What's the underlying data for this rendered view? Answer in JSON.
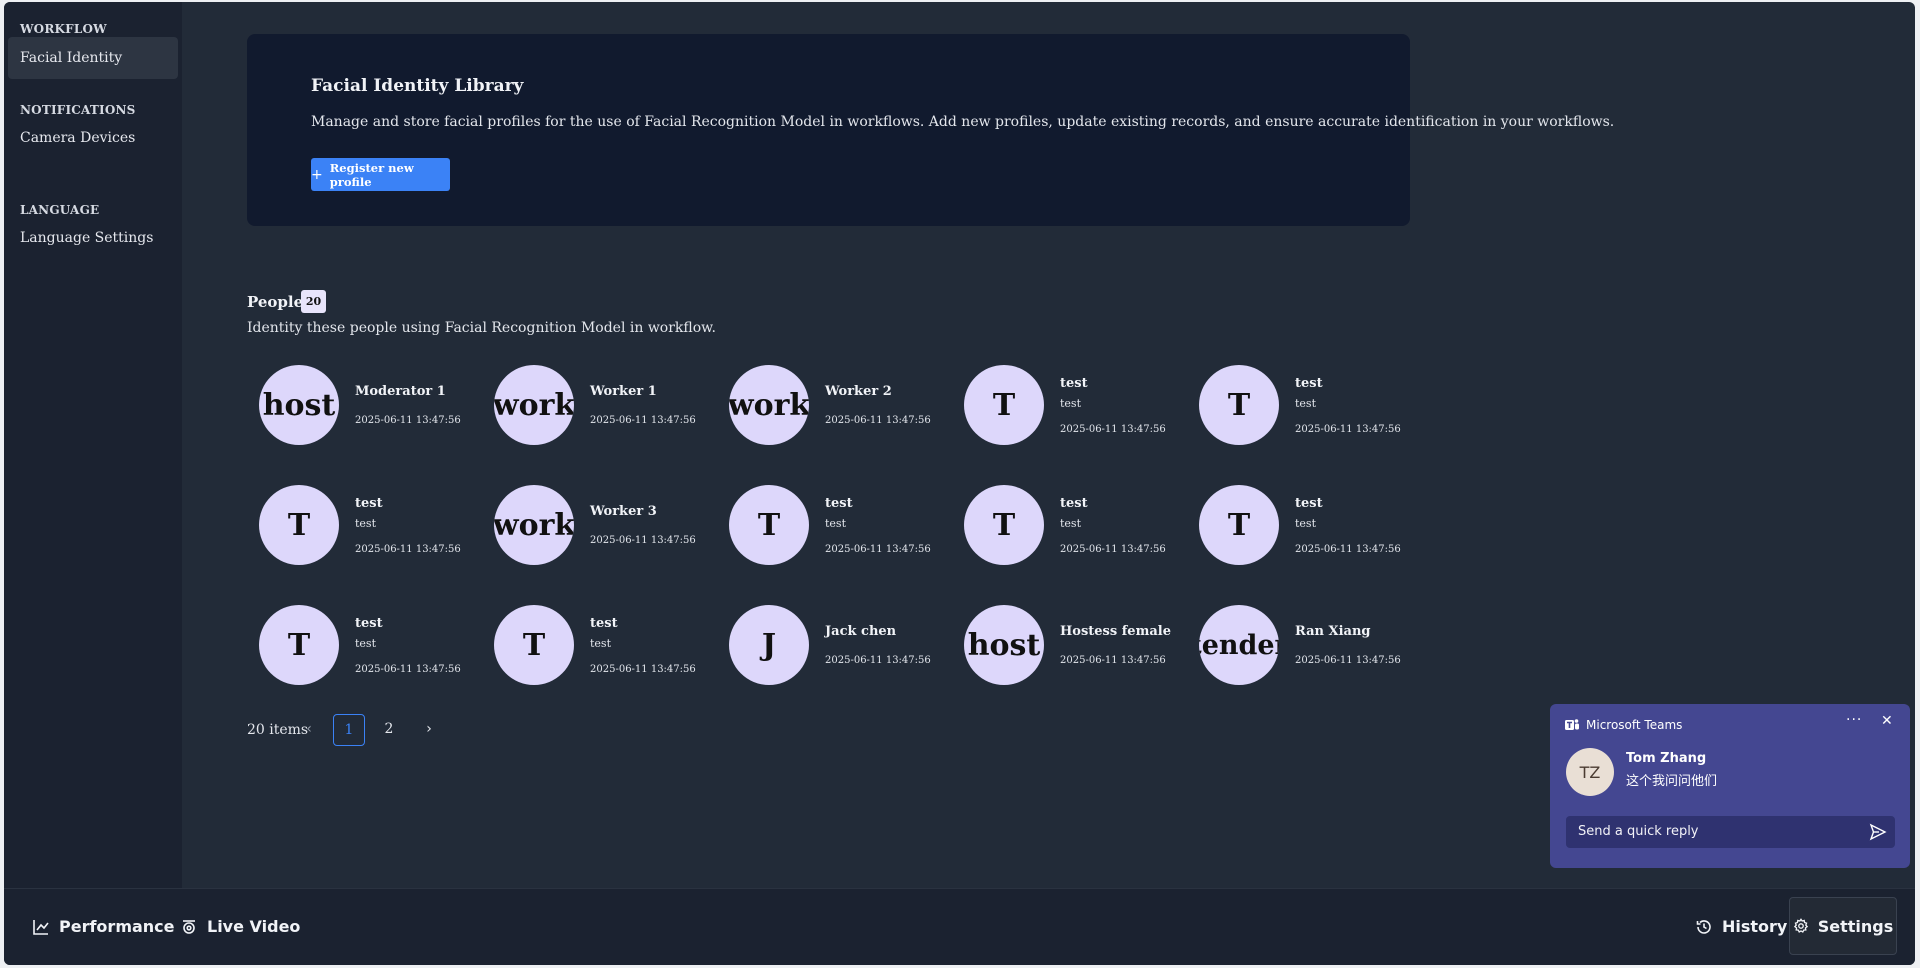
{
  "sidebar": {
    "sections": [
      {
        "title": "WORKFLOW",
        "items": [
          {
            "label": "Facial Identity",
            "active": true
          }
        ]
      },
      {
        "title": "NOTIFICATIONS",
        "items": [
          {
            "label": "Camera Devices",
            "active": false
          }
        ]
      },
      {
        "title": "LANGUAGE",
        "items": [
          {
            "label": "Language Settings",
            "active": false
          }
        ]
      }
    ]
  },
  "hero": {
    "title": "Facial Identity Library",
    "description": "Manage and store facial profiles for the use of Facial Recognition Model in workflows. Add new profiles, update existing records, and ensure accurate identification in your workflows.",
    "button_label": "Register new profile",
    "button_icon": "plus-icon"
  },
  "people": {
    "title": "People",
    "count": "20",
    "description": "Identity these people using Facial Recognition Model in workflow.",
    "cards": [
      {
        "avatar": "host",
        "name": "Moderator 1",
        "sub": "",
        "date": "2025-06-11 13:47:56"
      },
      {
        "avatar": "work",
        "name": "Worker 1",
        "sub": "",
        "date": "2025-06-11 13:47:56"
      },
      {
        "avatar": "work",
        "name": "Worker 2",
        "sub": "",
        "date": "2025-06-11 13:47:56"
      },
      {
        "avatar": "T",
        "name": "test",
        "sub": "test",
        "date": "2025-06-11 13:47:56"
      },
      {
        "avatar": "T",
        "name": "test",
        "sub": "test",
        "date": "2025-06-11 13:47:56"
      },
      {
        "avatar": "T",
        "name": "test",
        "sub": "test",
        "date": "2025-06-11 13:47:56"
      },
      {
        "avatar": "work",
        "name": "Worker 3",
        "sub": "",
        "date": "2025-06-11 13:47:56"
      },
      {
        "avatar": "T",
        "name": "test",
        "sub": "test",
        "date": "2025-06-11 13:47:56"
      },
      {
        "avatar": "T",
        "name": "test",
        "sub": "test",
        "date": "2025-06-11 13:47:56"
      },
      {
        "avatar": "T",
        "name": "test",
        "sub": "test",
        "date": "2025-06-11 13:47:56"
      },
      {
        "avatar": "T",
        "name": "test",
        "sub": "test",
        "date": "2025-06-11 13:47:56"
      },
      {
        "avatar": "T",
        "name": "test",
        "sub": "test",
        "date": "2025-06-11 13:47:56"
      },
      {
        "avatar": "J",
        "name": "Jack chen",
        "sub": "",
        "date": "2025-06-11 13:47:56"
      },
      {
        "avatar": "host",
        "name": "Hostess female",
        "sub": "",
        "date": "2025-06-11 13:47:56"
      },
      {
        "avatar": "tender",
        "name": "Ran Xiang",
        "sub": "",
        "date": "2025-06-11 13:47:56"
      }
    ]
  },
  "pagination": {
    "total_label": "20 items",
    "pages": [
      "1",
      "2"
    ],
    "current": "1",
    "prev_icon": "chevron-left-icon",
    "next_icon": "chevron-right-icon"
  },
  "bottombar": {
    "performance_label": "Performance",
    "live_video_label": "Live Video",
    "history_label": "History",
    "settings_label": "Settings"
  },
  "toast": {
    "app_name": "Microsoft Teams",
    "sender_initials": "TZ",
    "sender_name": "Tom Zhang",
    "message": "这个我问问他们",
    "reply_placeholder": "Send a quick reply",
    "more_icon": "more-icon",
    "close_icon": "close-icon",
    "send_icon": "send-icon"
  },
  "colors": {
    "accent": "#3b82f6",
    "app_bg": "#222b38",
    "sidebar_bg": "#1b2230",
    "hero_bg": "#111a2e",
    "avatar_bg": "#ddd7fb",
    "toast_bg": "#444791"
  }
}
